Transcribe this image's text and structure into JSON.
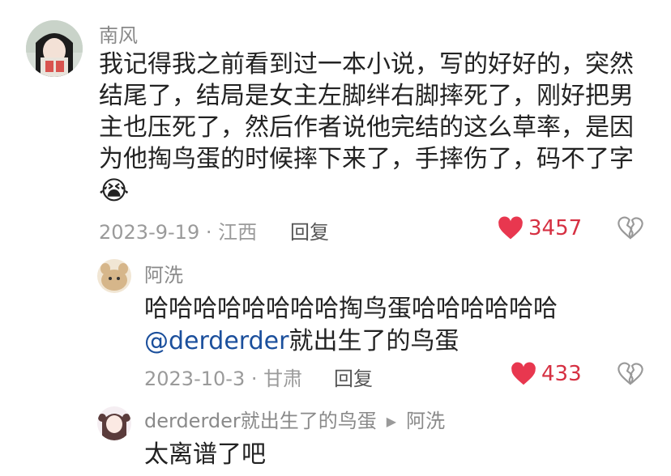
{
  "comments": [
    {
      "author": "南风",
      "lines": [
        "我记得我之前看到过一本小说，写的好好的，突然",
        "结尾了，结局是女主左脚绊右脚摔死了，刚好把男",
        "主也压死了，然后作者说他完结的这么草率，是因",
        "为他掏鸟蛋的时候摔下来了，手摔伤了，码不了字"
      ],
      "emoji": "😭",
      "meta": "2023-9-19 · 江西",
      "reply_label": "回复",
      "likes": "3457"
    },
    {
      "author": "阿洗",
      "line1": "哈哈哈哈哈哈哈哈掏鸟蛋哈哈哈哈哈哈",
      "mention": "@derderder",
      "line2_rest": "就出生了的鸟蛋",
      "meta": "2023-10-3 · 甘肃",
      "reply_label": "回复",
      "likes": "433"
    },
    {
      "author": "derderder就出生了的鸟蛋",
      "reply_to": "阿洗",
      "text": "太离谱了吧"
    }
  ],
  "colors": {
    "like": "#e8374f",
    "meta": "#9a9a9a",
    "mention": "#1b4f9c"
  }
}
